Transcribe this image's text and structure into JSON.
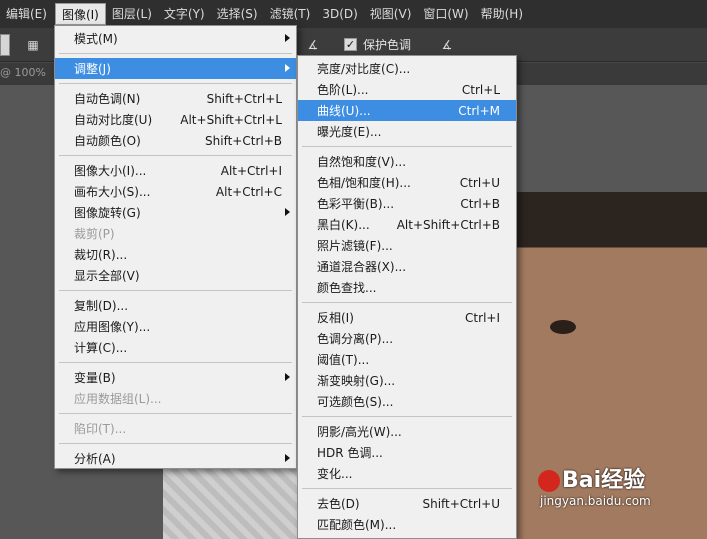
{
  "menubar": {
    "items": [
      {
        "label": "编辑(E)"
      },
      {
        "label": "图像(I)",
        "active": true
      },
      {
        "label": "图层(L)"
      },
      {
        "label": "文字(Y)"
      },
      {
        "label": "选择(S)"
      },
      {
        "label": "滤镜(T)"
      },
      {
        "label": "3D(D)"
      },
      {
        "label": "视图(V)"
      },
      {
        "label": "窗口(W)"
      },
      {
        "label": "帮助(H)"
      }
    ]
  },
  "options": {
    "protect_color_label": "保护色调",
    "protect_color_checked": true
  },
  "doc_tab": {
    "label": "@ 100%"
  },
  "image_menu": {
    "items": [
      {
        "label": "模式(M)",
        "submenu": true
      },
      {
        "sep": true
      },
      {
        "label": "调整(J)",
        "submenu": true,
        "highlighted": true
      },
      {
        "sep": true
      },
      {
        "label": "自动色调(N)",
        "shortcut": "Shift+Ctrl+L"
      },
      {
        "label": "自动对比度(U)",
        "shortcut": "Alt+Shift+Ctrl+L"
      },
      {
        "label": "自动颜色(O)",
        "shortcut": "Shift+Ctrl+B"
      },
      {
        "sep": true
      },
      {
        "label": "图像大小(I)...",
        "shortcut": "Alt+Ctrl+I"
      },
      {
        "label": "画布大小(S)...",
        "shortcut": "Alt+Ctrl+C"
      },
      {
        "label": "图像旋转(G)",
        "submenu": true
      },
      {
        "label": "裁剪(P)",
        "disabled": true
      },
      {
        "label": "裁切(R)..."
      },
      {
        "label": "显示全部(V)"
      },
      {
        "sep": true
      },
      {
        "label": "复制(D)..."
      },
      {
        "label": "应用图像(Y)..."
      },
      {
        "label": "计算(C)..."
      },
      {
        "sep": true
      },
      {
        "label": "变量(B)",
        "submenu": true
      },
      {
        "label": "应用数据组(L)...",
        "disabled": true
      },
      {
        "sep": true
      },
      {
        "label": "陷印(T)...",
        "disabled": true
      },
      {
        "sep": true
      },
      {
        "label": "分析(A)",
        "submenu": true
      }
    ]
  },
  "adjust_menu": {
    "items": [
      {
        "label": "亮度/对比度(C)..."
      },
      {
        "label": "色阶(L)...",
        "shortcut": "Ctrl+L"
      },
      {
        "label": "曲线(U)...",
        "shortcut": "Ctrl+M",
        "highlighted": true
      },
      {
        "label": "曝光度(E)..."
      },
      {
        "sep": true
      },
      {
        "label": "自然饱和度(V)..."
      },
      {
        "label": "色相/饱和度(H)...",
        "shortcut": "Ctrl+U"
      },
      {
        "label": "色彩平衡(B)...",
        "shortcut": "Ctrl+B"
      },
      {
        "label": "黑白(K)...",
        "shortcut": "Alt+Shift+Ctrl+B"
      },
      {
        "label": "照片滤镜(F)..."
      },
      {
        "label": "通道混合器(X)..."
      },
      {
        "label": "颜色查找..."
      },
      {
        "sep": true
      },
      {
        "label": "反相(I)",
        "shortcut": "Ctrl+I"
      },
      {
        "label": "色调分离(P)..."
      },
      {
        "label": "阈值(T)..."
      },
      {
        "label": "渐变映射(G)..."
      },
      {
        "label": "可选颜色(S)..."
      },
      {
        "sep": true
      },
      {
        "label": "阴影/高光(W)..."
      },
      {
        "label": "HDR 色调..."
      },
      {
        "label": "变化..."
      },
      {
        "sep": true
      },
      {
        "label": "去色(D)",
        "shortcut": "Shift+Ctrl+U"
      },
      {
        "label": "匹配颜色(M)..."
      }
    ]
  },
  "watermark": {
    "brand": "Bai经验",
    "url": "jingyan.baidu.com"
  },
  "colors": {
    "highlight": "#3d8ee2",
    "menu_bg": "#f0f0f0",
    "menubar_bg": "#2f2f2f"
  }
}
